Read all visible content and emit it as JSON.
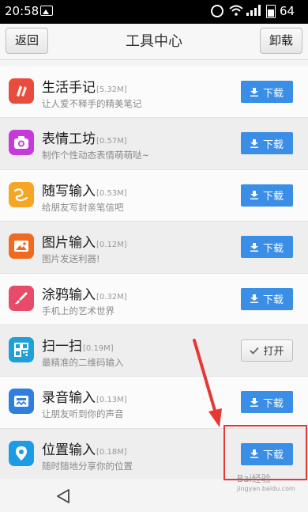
{
  "status_bar": {
    "time": "20:58",
    "battery": "64"
  },
  "header": {
    "back_label": "返回",
    "title": "工具中心",
    "uninstall_label": "卸载"
  },
  "apps": [
    {
      "name": "生活手记",
      "size": "[5.32M]",
      "desc": "让人爱不释手的精美笔记",
      "action": "下载",
      "color": "#e74c3c",
      "icon": "note-icon"
    },
    {
      "name": "表情工坊",
      "size": "[0.57M]",
      "desc": "制作个性动态表情萌萌哒~",
      "action": "下载",
      "color": "#c43bd9",
      "icon": "camera-icon"
    },
    {
      "name": "随写输入",
      "size": "[0.53M]",
      "desc": "给朋友写封亲笔信吧",
      "action": "下载",
      "color": "#f5a623",
      "icon": "handwrite-icon"
    },
    {
      "name": "图片输入",
      "size": "[0.12M]",
      "desc": "图片发送利器!",
      "action": "下载",
      "color": "#f06b1f",
      "icon": "picture-icon"
    },
    {
      "name": "涂鸦输入",
      "size": "[0.32M]",
      "desc": "手机上的艺术世界",
      "action": "下载",
      "color": "#e84b6a",
      "icon": "brush-icon"
    },
    {
      "name": "扫一扫",
      "size": "[0.19M]",
      "desc": "最精准的二维码输入",
      "action": "打开",
      "color": "#1fa0d8",
      "icon": "qrcode-icon"
    },
    {
      "name": "录音输入",
      "size": "[0.13M]",
      "desc": "让朋友听到你的声音",
      "action": "下载",
      "color": "#2f7fe0",
      "icon": "recorder-icon"
    },
    {
      "name": "位置输入",
      "size": "[0.18M]",
      "desc": "随时随地分享你的位置",
      "action": "下载",
      "color": "#1e9be6",
      "icon": "location-icon"
    }
  ],
  "watermark": {
    "line1": "Bai经验",
    "line2": "jingyan.baidu.com"
  }
}
